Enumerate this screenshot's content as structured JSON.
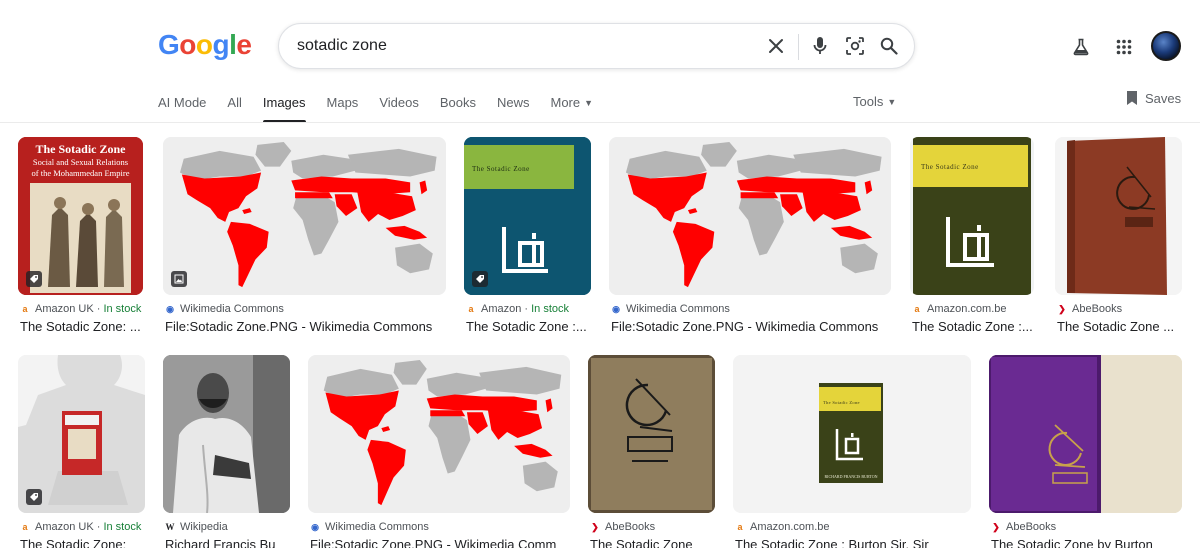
{
  "logo": {
    "letters": [
      "G",
      "o",
      "o",
      "g",
      "l",
      "e"
    ],
    "colors": [
      "#4285F4",
      "#EA4335",
      "#FBBC05",
      "#4285F4",
      "#34A853",
      "#EA4335"
    ]
  },
  "search": {
    "query": "sotadic zone"
  },
  "icons": {
    "clear": "close-icon",
    "voice": "microphone-icon",
    "lens": "lens-icon",
    "search": "search-icon",
    "labs": "flask-icon",
    "apps": "apps-grid-icon"
  },
  "tabs": [
    {
      "label": "AI Mode",
      "active": false
    },
    {
      "label": "All",
      "active": false
    },
    {
      "label": "Images",
      "active": true
    },
    {
      "label": "Maps",
      "active": false
    },
    {
      "label": "Videos",
      "active": false
    },
    {
      "label": "Books",
      "active": false
    },
    {
      "label": "News",
      "active": false
    },
    {
      "label": "More",
      "active": false,
      "dropdown": true
    }
  ],
  "tools_label": "Tools",
  "saves_label": "Saves",
  "row1": [
    {
      "source": "Amazon UK",
      "stock": "In stock",
      "title": "The Sotadic Zone: ...",
      "fav": "amazon",
      "badge": "tag-icon"
    },
    {
      "source": "Wikimedia Commons",
      "stock": "",
      "title": "File:Sotadic Zone.PNG - Wikimedia Commons",
      "fav": "wikimedia",
      "badge": "image-icon"
    },
    {
      "source": "Amazon",
      "stock": "In stock",
      "title": "The Sotadic Zone :...",
      "fav": "amazon",
      "badge": "tag-icon"
    },
    {
      "source": "Wikimedia Commons",
      "stock": "",
      "title": "File:Sotadic Zone.PNG - Wikimedia Commons",
      "fav": "wikimedia",
      "badge": ""
    },
    {
      "source": "Amazon.com.be",
      "stock": "",
      "title": "The Sotadic Zone :...",
      "fav": "amazon",
      "badge": ""
    },
    {
      "source": "AbeBooks",
      "stock": "",
      "title": "The Sotadic Zone ...",
      "fav": "abebooks",
      "badge": ""
    }
  ],
  "row2": [
    {
      "source": "Amazon UK",
      "stock": "In stock",
      "title": "The Sotadic Zone:",
      "fav": "amazon",
      "badge": "tag-icon"
    },
    {
      "source": "Wikipedia",
      "stock": "",
      "title": "Richard Francis Bu",
      "fav": "wikipedia",
      "badge": ""
    },
    {
      "source": "Wikimedia Commons",
      "stock": "",
      "title": "File:Sotadic Zone.PNG - Wikimedia Comm",
      "fav": "wikimedia",
      "badge": ""
    },
    {
      "source": "AbeBooks",
      "stock": "",
      "title": "The Sotadic Zone",
      "fav": "abebooks",
      "badge": ""
    },
    {
      "source": "Amazon.com.be",
      "stock": "",
      "title": "The Sotadic Zone : Burton Sir. Sir",
      "fav": "amazon",
      "badge": ""
    },
    {
      "source": "AbeBooks",
      "stock": "",
      "title": "The Sotadic Zone by Burton",
      "fav": "abebooks",
      "badge": ""
    }
  ],
  "book1": {
    "title": "The Sotadic Zone",
    "subtitle1": "Social and Sexual Relations",
    "subtitle2": "of the Mohammedan Empire"
  },
  "book2": {
    "title": "The Sotadic Zone"
  },
  "book3": {
    "title": "The Sotadic Zone"
  },
  "book4": {
    "author": "Richard Francis Burton"
  },
  "colors": {
    "accent": "#1a73e8",
    "stock": "#188038",
    "map_red": "#ff0000",
    "map_grey": "#b5b5b5"
  }
}
